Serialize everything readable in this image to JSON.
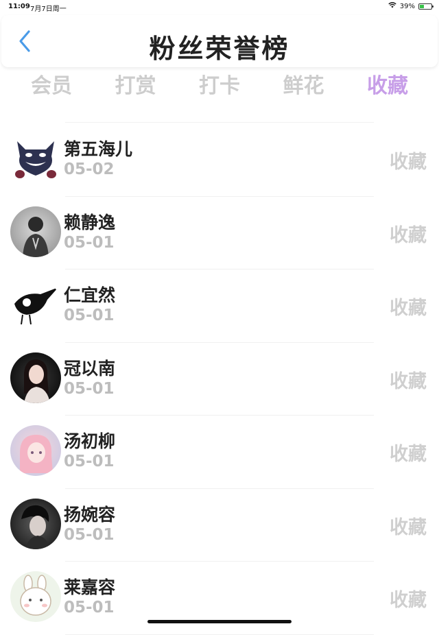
{
  "status_bar": {
    "time": "11:09",
    "date": "7月7日周一",
    "battery": "39%",
    "battery_level": 0.39
  },
  "header": {
    "title": "粉丝荣誉榜"
  },
  "tabs": [
    {
      "label": "会员",
      "active": false
    },
    {
      "label": "打赏",
      "active": false
    },
    {
      "label": "打卡",
      "active": false
    },
    {
      "label": "鲜花",
      "active": false
    },
    {
      "label": "收藏",
      "active": true
    }
  ],
  "colors": {
    "accent": "#c79ee8",
    "back_arrow": "#4a9be8",
    "inactive_tab": "#cdcdcd",
    "muted_text": "#bdbdbd"
  },
  "fans": [
    {
      "name": "第五海儿",
      "date": "05-02",
      "type": "收藏",
      "avatar": "dark-blue-cat-avatar"
    },
    {
      "name": "赖静逸",
      "date": "05-01",
      "type": "收藏",
      "avatar": "grey-sketch-boy-avatar"
    },
    {
      "name": "仁宜然",
      "date": "05-01",
      "type": "收藏",
      "avatar": "black-white-ink-bird-avatar"
    },
    {
      "name": "冠以南",
      "date": "05-01",
      "type": "收藏",
      "avatar": "woman-dark-background-avatar"
    },
    {
      "name": "汤初柳",
      "date": "05-01",
      "type": "收藏",
      "avatar": "pink-anime-girl-avatar"
    },
    {
      "name": "扬婉容",
      "date": "05-01",
      "type": "收藏",
      "avatar": "dark-portrait-avatar"
    },
    {
      "name": "莱嘉容",
      "date": "05-01",
      "type": "收藏",
      "avatar": "cartoon-bunny-avatar"
    }
  ]
}
